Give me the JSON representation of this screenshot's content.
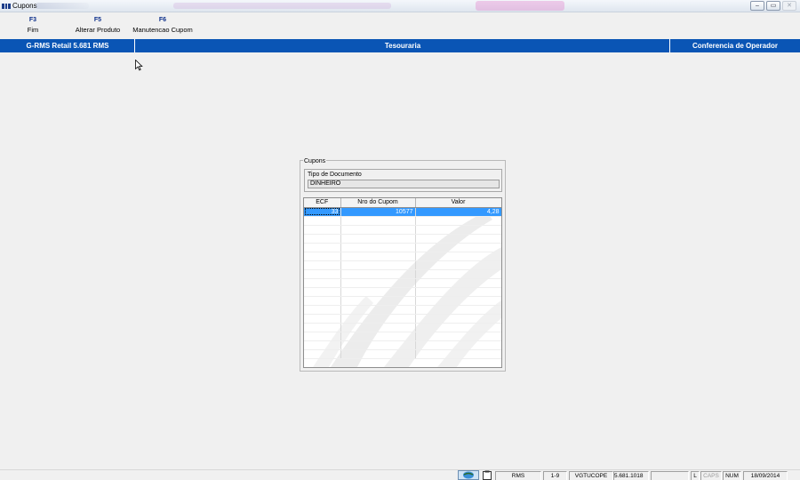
{
  "window": {
    "title": "Cupons",
    "controls": {
      "minimize": "–",
      "maximize": "▭",
      "close": "✕"
    }
  },
  "toolbar": {
    "keys": [
      {
        "key": "F3",
        "label": "Fim"
      },
      {
        "key": "F5",
        "label": "Alterar Produto"
      },
      {
        "key": "F6",
        "label": "Manutencao Cupom"
      }
    ]
  },
  "header": {
    "left": "G-RMS Retail 5.681 RMS",
    "center": "Tesouraria",
    "right": "Conferencia de Operador"
  },
  "dialog": {
    "title": "Cupons",
    "doc_type_label": "Tipo de Documento",
    "doc_type_value": "DINHEIRO",
    "columns": [
      "ECF",
      "Nro do Cupom",
      "Valor"
    ],
    "rows": [
      {
        "ecf": "33",
        "cupom": "10577",
        "valor": "4,28"
      }
    ]
  },
  "statusbar": {
    "cells": [
      "RMS",
      "1-9",
      "VGTUCOPE",
      "5.681.1018",
      "",
      "L",
      "CAPS",
      "NUM",
      "18/09/2014"
    ]
  },
  "colors": {
    "header_bg": "#0a55b5",
    "selection": "#3399ff",
    "fkey": "#0a2d8a"
  },
  "icons": [
    "app-icon",
    "mouse-cursor-icon",
    "globe-icon",
    "clipboard-icon"
  ]
}
